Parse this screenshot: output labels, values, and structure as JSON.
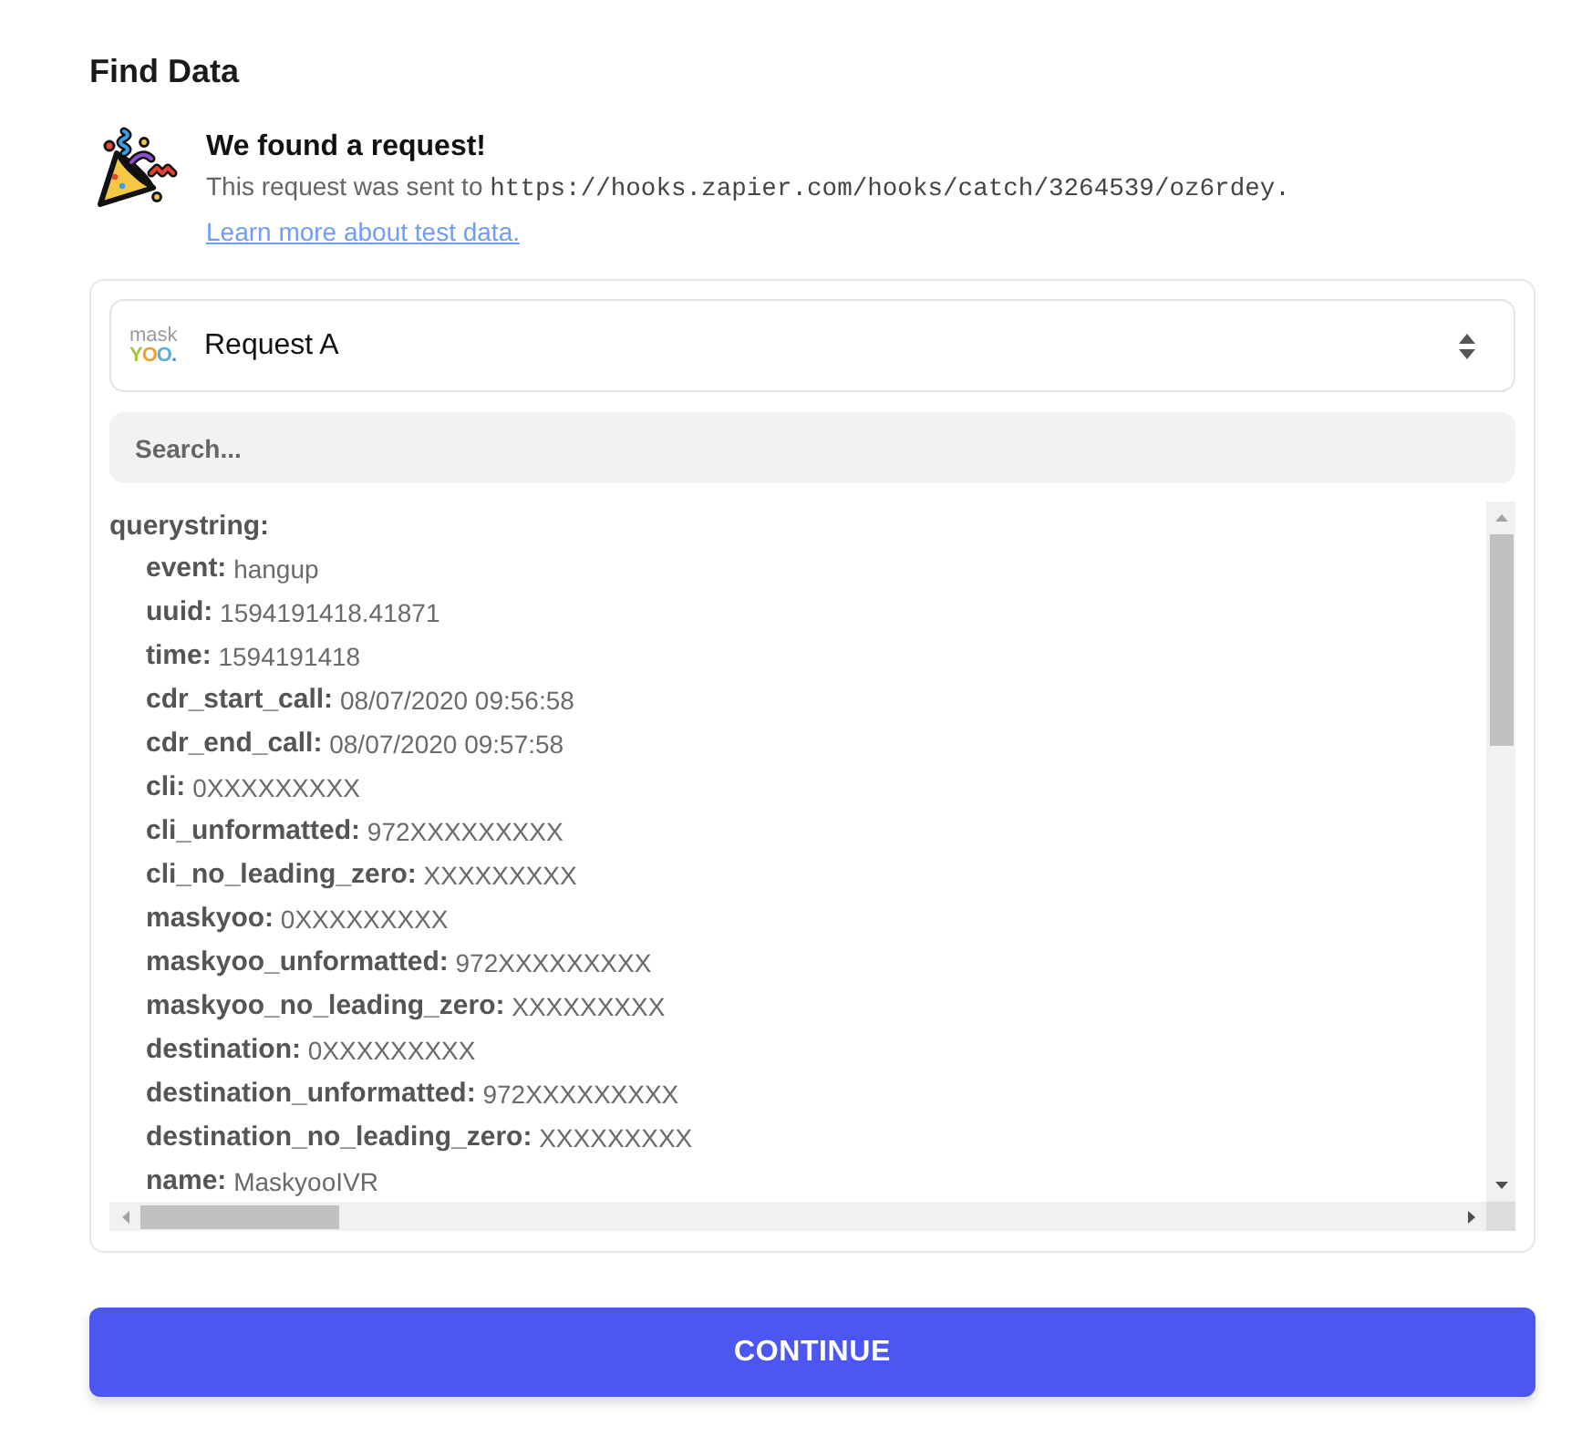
{
  "heading": "Find Data",
  "notice": {
    "title": "We found a request!",
    "intro": "This request was sent to",
    "url": "https://hooks.zapier.com/hooks/catch/3264539/oz6rdey.",
    "link": "Learn more about test data."
  },
  "request_select": {
    "logo": {
      "top": "mask",
      "bottom": "YOO."
    },
    "value": "Request A"
  },
  "search": {
    "placeholder": "Search..."
  },
  "data": [
    {
      "key": "querystring:",
      "children": [
        {
          "key": "event:",
          "value": "hangup"
        },
        {
          "key": "uuid:",
          "value": "1594191418.41871"
        },
        {
          "key": "time:",
          "value": "1594191418"
        },
        {
          "key": "cdr_start_call:",
          "value": "08/07/2020 09:56:58"
        },
        {
          "key": "cdr_end_call:",
          "value": "08/07/2020 09:57:58"
        },
        {
          "key": "cli:",
          "value": "0XXXXXXXXX"
        },
        {
          "key": "cli_unformatted:",
          "value": "972XXXXXXXXX"
        },
        {
          "key": "cli_no_leading_zero:",
          "value": "XXXXXXXXX"
        },
        {
          "key": "maskyoo:",
          "value": "0XXXXXXXXX"
        },
        {
          "key": "maskyoo_unformatted:",
          "value": "972XXXXXXXXX"
        },
        {
          "key": "maskyoo_no_leading_zero:",
          "value": "XXXXXXXXX"
        },
        {
          "key": "destination:",
          "value": "0XXXXXXXXX"
        },
        {
          "key": "destination_unformatted:",
          "value": "972XXXXXXXXX"
        },
        {
          "key": "destination_no_leading_zero:",
          "value": "XXXXXXXXX"
        },
        {
          "key": "name:",
          "value": "MaskyooIVR"
        }
      ]
    }
  ],
  "button": "CONTINUE"
}
